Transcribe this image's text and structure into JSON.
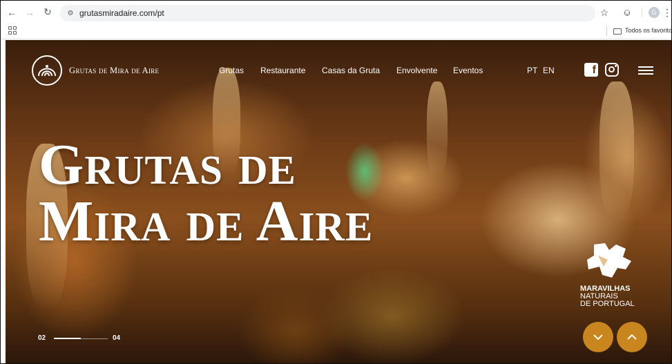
{
  "browser": {
    "url": "grutasmiradaire.com/pt",
    "profile_initial": "G",
    "all_bookmarks_label": "Todos os favoritos"
  },
  "site": {
    "brand": "Grutas de Mira de Aire",
    "nav": [
      {
        "label": "Grutas"
      },
      {
        "label": "Restaurante"
      },
      {
        "label": "Casas da Gruta"
      },
      {
        "label": "Envolvente"
      },
      {
        "label": "Eventos"
      }
    ],
    "languages": [
      "PT",
      "EN"
    ],
    "social": [
      "facebook-icon",
      "instagram-icon"
    ]
  },
  "hero": {
    "title_line1": "Grutas de",
    "title_line2": "Mira de Aire",
    "slider": {
      "current": "02",
      "total": "04",
      "progress": 0.5
    }
  },
  "badge": {
    "line1": "MARAVILHAS",
    "line2": "NATURAIS",
    "line3": "DE PORTUGAL"
  },
  "colors": {
    "accent": "#c9861f",
    "text_on_hero": "#ffffff"
  }
}
